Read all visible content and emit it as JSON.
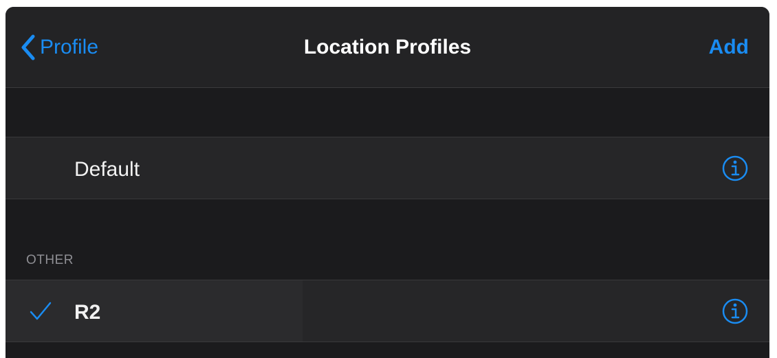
{
  "navbar": {
    "back_label": "Profile",
    "title": "Location Profiles",
    "add_label": "Add"
  },
  "sections": [
    {
      "header": "",
      "items": [
        {
          "label": "Default",
          "checked": false,
          "icon": "info-icon"
        }
      ]
    },
    {
      "header": "OTHER",
      "items": [
        {
          "label": "R2",
          "checked": true,
          "icon": "info-icon"
        }
      ]
    }
  ],
  "colors": {
    "accent": "#1a8cf2",
    "background": "#1b1b1d",
    "navbar": "#232325",
    "row": "#262628",
    "text": "#f2f2f2",
    "section_header": "#8e8e93"
  }
}
